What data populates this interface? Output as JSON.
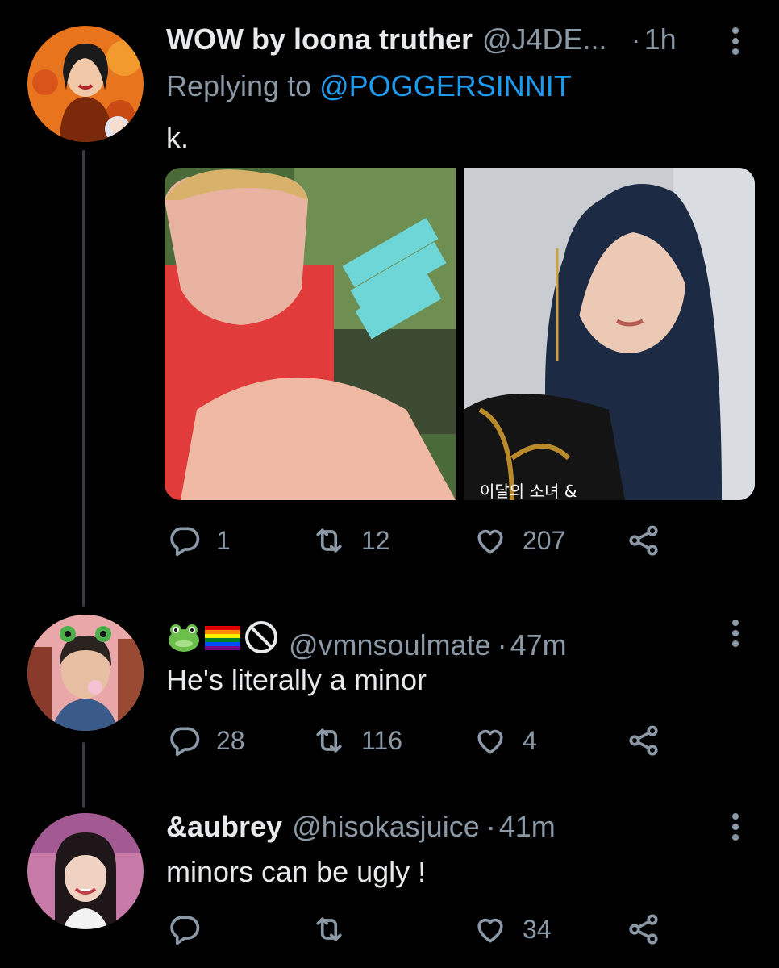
{
  "tweets": [
    {
      "display_name": "WOW by loona truther",
      "handle": "@J4DE...",
      "dot": "·",
      "time": "1h",
      "replying_prefix": "Replying to",
      "replying_handle": "@POGGERSINNIT",
      "text": "k.",
      "media_caption": "이달의 소녀 &",
      "replies": "1",
      "retweets": "12",
      "likes": "207"
    },
    {
      "display_name": "",
      "name_emojis": [
        "frog-emoji",
        "rainbow-flag-emoji",
        "prohibited-emoji"
      ],
      "handle": "@vmnsoulmate",
      "dot": "·",
      "time": "47m",
      "text": "He's literally a minor",
      "replies": "28",
      "retweets": "116",
      "likes": "4"
    },
    {
      "display_name": "&aubrey",
      "handle": "@hisokasjuice",
      "dot": "·",
      "time": "41m",
      "text": "minors can be ugly !",
      "replies": "",
      "retweets": "",
      "likes": "34"
    }
  ],
  "icons": {
    "reply": "reply-icon",
    "retweet": "retweet-icon",
    "like": "heart-icon",
    "share": "share-icon",
    "more": "more-vertical-icon"
  },
  "colors": {
    "background": "#000000",
    "primary_text": "#e7e9ea",
    "secondary_text": "#8b98a5",
    "link": "#1d9bf0",
    "thread_line": "#3a3d41"
  }
}
